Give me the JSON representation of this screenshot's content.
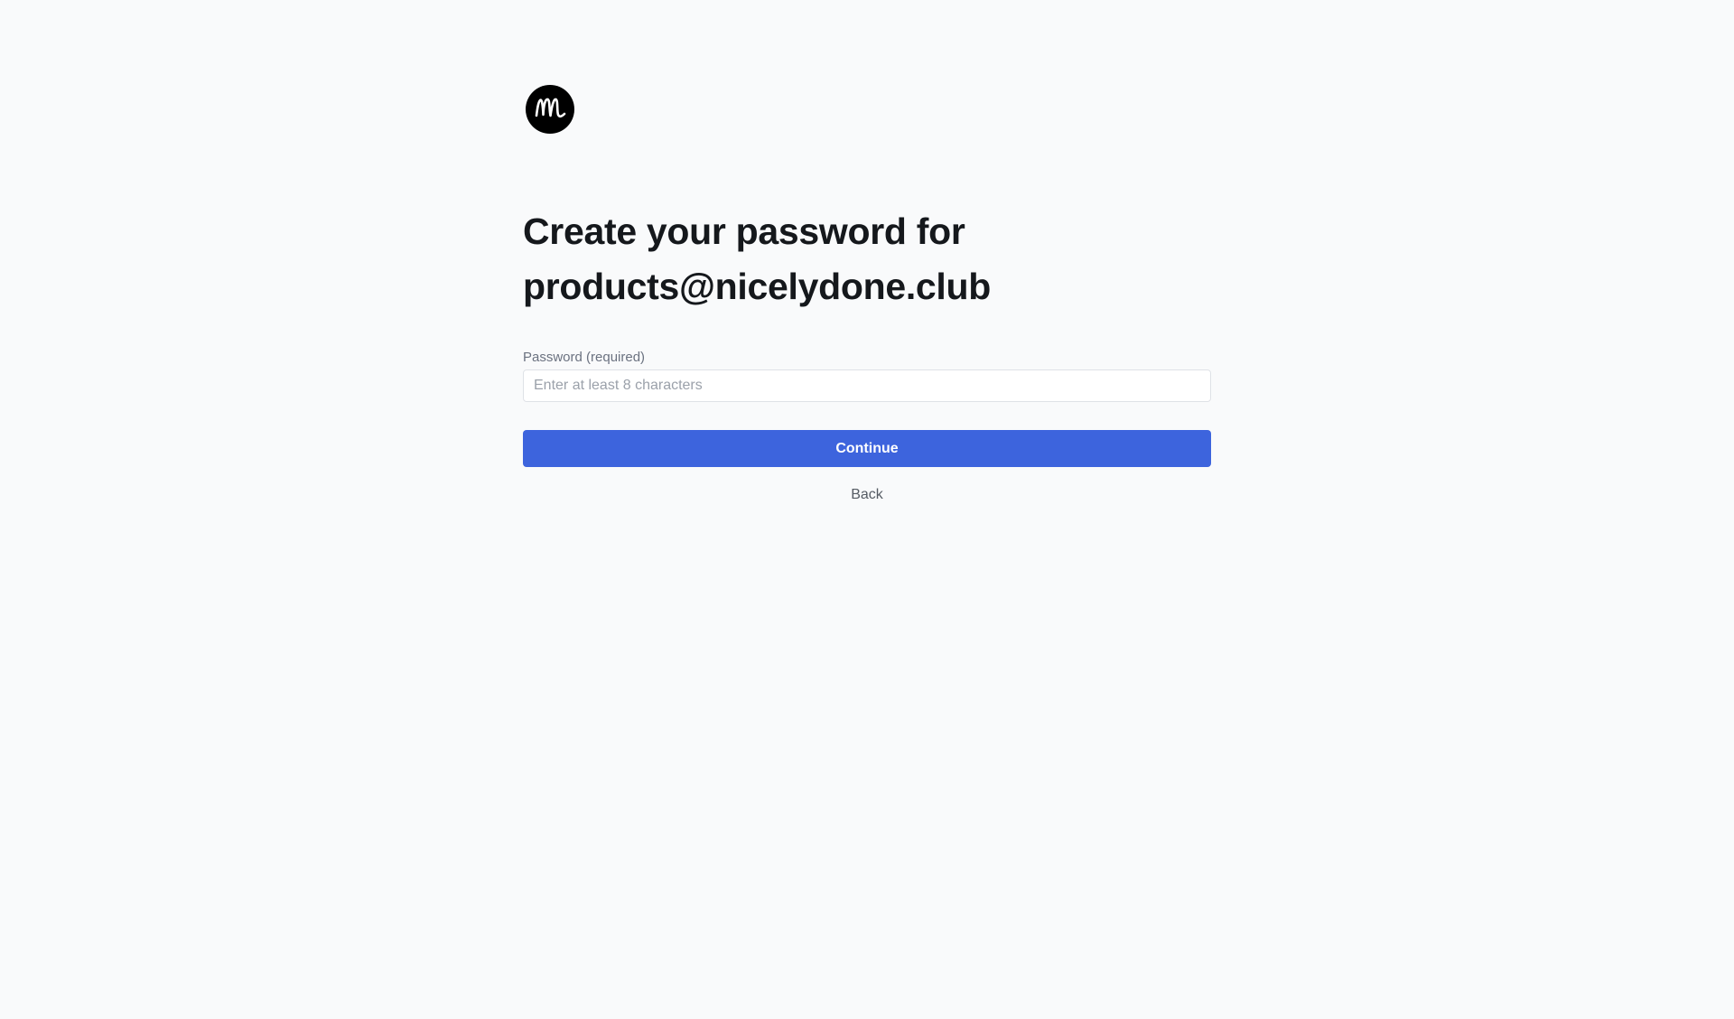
{
  "logo": {
    "icon": "m-wave-logo-icon",
    "color": "#000000"
  },
  "heading": {
    "line1": "Create your password for",
    "line2": "products@nicelydone.club"
  },
  "password_field": {
    "label": "Password (required)",
    "placeholder": "Enter at least 8 characters",
    "value": ""
  },
  "actions": {
    "continue_label": "Continue",
    "back_label": "Back"
  },
  "colors": {
    "background": "#f9fafb",
    "primary": "#3d64dd",
    "heading": "#15181c",
    "muted": "#6b7280"
  }
}
